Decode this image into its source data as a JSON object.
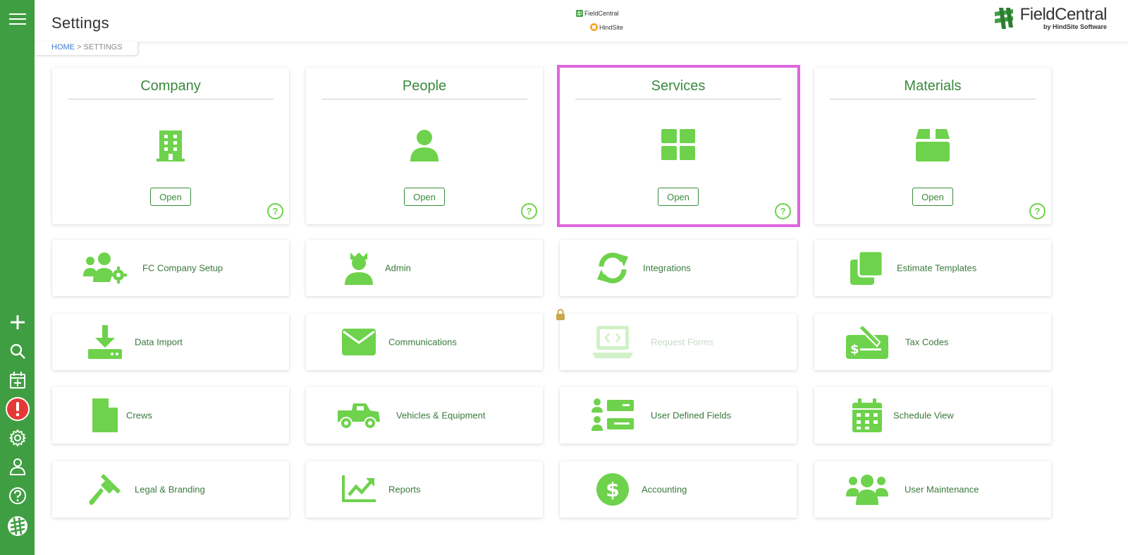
{
  "header": {
    "title": "Settings"
  },
  "breadcrumb": {
    "home": "HOME",
    "separator": " > ",
    "current": "SETTINGS"
  },
  "center_logo": {
    "line1": "FieldCentral",
    "line2": "HindSite"
  },
  "brand": {
    "name": "FieldCentral",
    "sub": "by HindSite Software"
  },
  "colors": {
    "sidebar": "#3f9e41",
    "icon_green": "#6ed24c",
    "title_green": "#3a8a3c",
    "highlight": "#dd66dd",
    "alert_red": "#e53935"
  },
  "sidebar": {
    "items": [
      {
        "icon": "hamburger-menu-icon"
      },
      {
        "icon": "plus-icon"
      },
      {
        "icon": "search-icon"
      },
      {
        "icon": "calendar-add-icon"
      },
      {
        "icon": "alert-icon"
      },
      {
        "icon": "gear-icon"
      },
      {
        "icon": "user-icon"
      },
      {
        "icon": "help-icon"
      },
      {
        "icon": "fieldcentral-logo-icon"
      }
    ]
  },
  "main_cards": [
    {
      "title": "Company",
      "icon": "building-icon",
      "button": "Open",
      "help": "?"
    },
    {
      "title": "People",
      "icon": "person-icon",
      "button": "Open",
      "help": "?"
    },
    {
      "title": "Services",
      "icon": "grid-icon",
      "button": "Open",
      "help": "?",
      "highlighted": true
    },
    {
      "title": "Materials",
      "icon": "box-icon",
      "button": "Open",
      "help": "?"
    }
  ],
  "tiles": [
    {
      "label": "FC Company Setup",
      "icon": "users-gear-icon"
    },
    {
      "label": "Admin",
      "icon": "admin-icon"
    },
    {
      "label": "Integrations",
      "icon": "sync-icon"
    },
    {
      "label": "Estimate Templates",
      "icon": "copy-icon"
    },
    {
      "label": "Data Import",
      "icon": "download-icon"
    },
    {
      "label": "Communications",
      "icon": "envelope-icon"
    },
    {
      "label": "Request Forms",
      "icon": "laptop-code-icon",
      "disabled": true
    },
    {
      "label": "Tax Codes",
      "icon": "tax-check-icon"
    },
    {
      "label": "Crews",
      "icon": "file-icon"
    },
    {
      "label": "Vehicles & Equipment",
      "icon": "truck-icon"
    },
    {
      "label": "User Defined Fields",
      "icon": "user-fields-icon"
    },
    {
      "label": "Schedule View",
      "icon": "calendar-icon"
    },
    {
      "label": "Legal & Branding",
      "icon": "gavel-icon"
    },
    {
      "label": "Reports",
      "icon": "chart-line-icon"
    },
    {
      "label": "Accounting",
      "icon": "dollar-circle-icon"
    },
    {
      "label": "User Maintenance",
      "icon": "users-icon"
    }
  ]
}
